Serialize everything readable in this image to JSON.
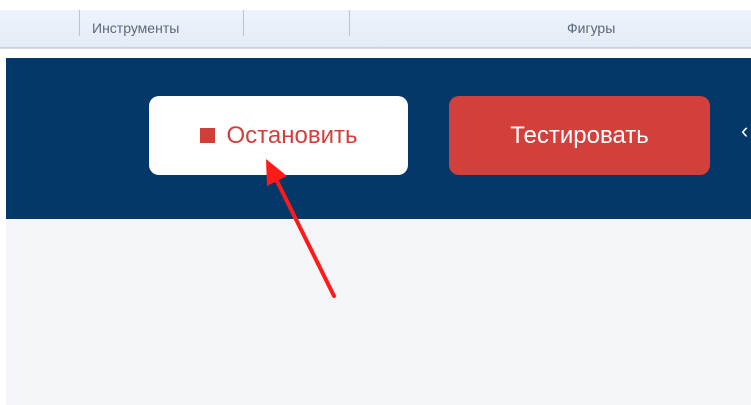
{
  "ribbon": {
    "groups": [
      {
        "label": "Инструменты"
      },
      {
        "label": "Фигуры"
      }
    ]
  },
  "toolbar": {
    "stop_label": "Остановить",
    "test_label": "Тестировать",
    "edge_glyph": "‹"
  },
  "colors": {
    "toolbar_bg": "#033868",
    "accent_red": "#d3403c",
    "annotation_arrow": "#ff1a1a"
  },
  "icons": {
    "stop": "stop-square-icon"
  }
}
